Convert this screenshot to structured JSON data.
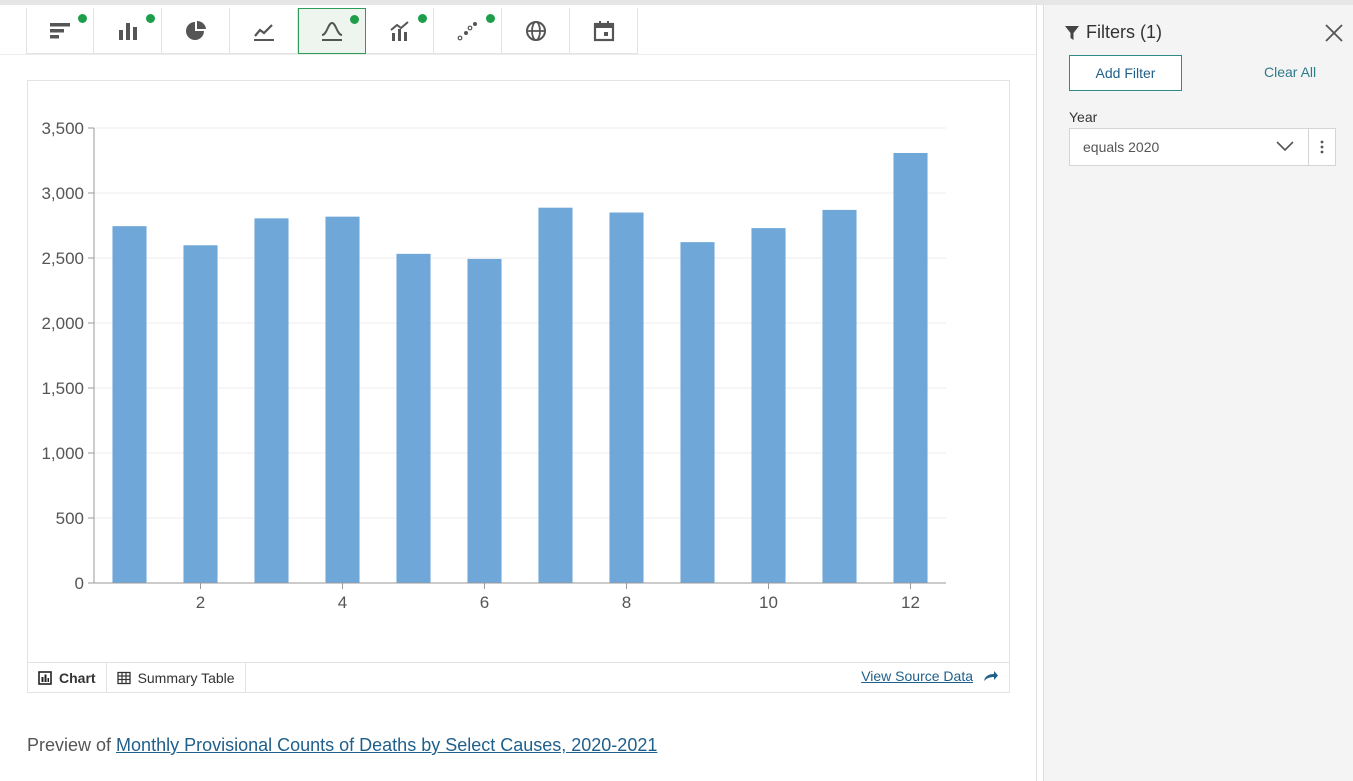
{
  "toolbar": {
    "buttons": [
      {
        "icon": "horizontal-bar-chart-icon",
        "has_dot": true
      },
      {
        "icon": "column-chart-icon",
        "has_dot": true
      },
      {
        "icon": "pie-chart-icon",
        "has_dot": false
      },
      {
        "icon": "line-chart-icon",
        "has_dot": false
      },
      {
        "icon": "distribution-curve-icon",
        "has_dot": true,
        "active": true
      },
      {
        "icon": "combo-chart-icon",
        "has_dot": true
      },
      {
        "icon": "scatter-plot-icon",
        "has_dot": true
      },
      {
        "icon": "globe-map-icon",
        "has_dot": false
      },
      {
        "icon": "calendar-icon",
        "has_dot": false
      }
    ]
  },
  "chart_data": {
    "type": "bar",
    "x": [
      1,
      2,
      3,
      4,
      5,
      6,
      7,
      8,
      9,
      10,
      11,
      12
    ],
    "values": [
      2745,
      2598,
      2805,
      2818,
      2532,
      2493,
      2887,
      2850,
      2622,
      2730,
      2870,
      3308
    ],
    "xticks": [
      "2",
      "4",
      "6",
      "8",
      "10",
      "12"
    ],
    "yticks": [
      "0",
      "500",
      "1,000",
      "1,500",
      "2,000",
      "2,500",
      "3,000",
      "3,500"
    ],
    "ylim": [
      0,
      3500
    ],
    "bar_color": "#6fa8d8",
    "grid": true
  },
  "footer": {
    "tab_chart": "Chart",
    "tab_summary": "Summary Table",
    "view_source": "View Source Data"
  },
  "preview": {
    "prefix": "Preview of ",
    "link": "Monthly Provisional Counts of Deaths by Select Causes, 2020-2021"
  },
  "filters": {
    "title": "Filters (1)",
    "add_filter": "Add Filter",
    "clear_all": "Clear All",
    "field_label": "Year",
    "field_value": "equals 2020"
  }
}
